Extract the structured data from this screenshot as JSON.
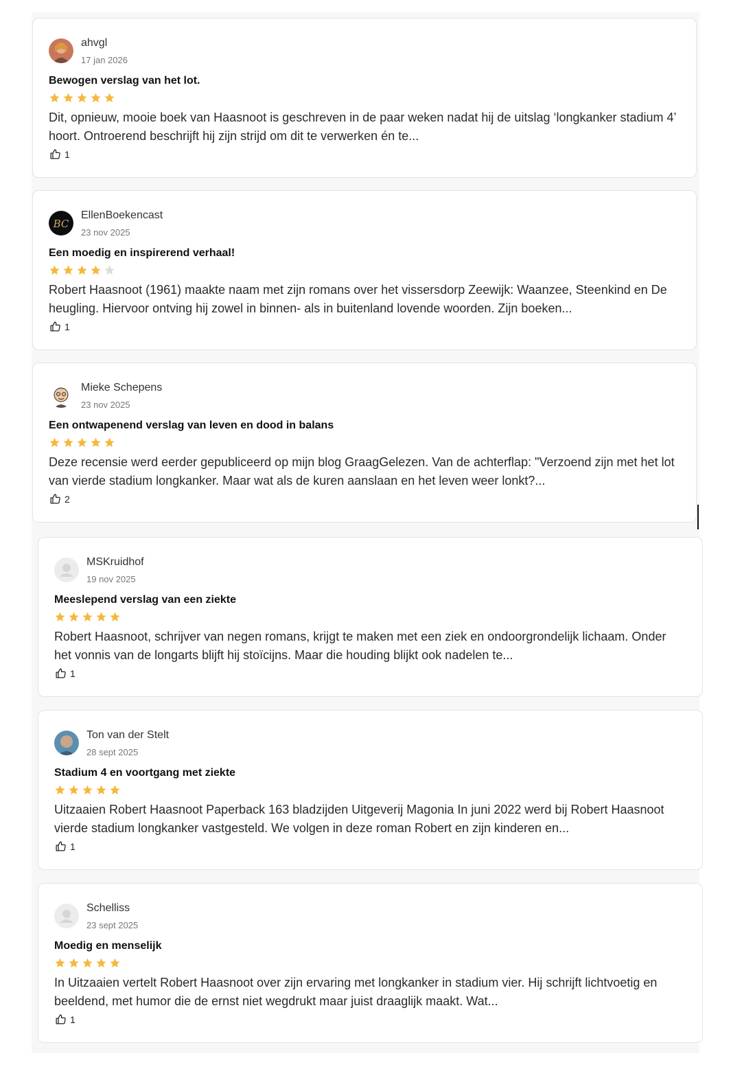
{
  "reviews": [
    {
      "author": "ahvgl",
      "date": "17 jan 2026",
      "title": "Bewogen verslag van het lot.",
      "rating": 5,
      "body": "Dit, opnieuw, mooie boek van Haasnoot is geschreven in de paar weken nadat hij de uitslag ‘longkanker stadium 4’ hoort. Ontroerend beschrijft hij zijn strijd om dit te verwerken én te...",
      "likes": "1",
      "avatar_icon": "user-photo-icon"
    },
    {
      "author": "EllenBoekencast",
      "date": "23 nov 2025",
      "title": "Een moedig en inspirerend verhaal!",
      "rating": 4,
      "body": "Robert Haasnoot (1961) maakte naam met zijn romans over het vissersdorp Zeewijk: Waanzee, Steenkind en De heugling. Hiervoor ontving hij zowel in binnen- als in buitenland lovende woorden. Zijn boeken...",
      "likes": "1",
      "avatar_icon": "bc-logo-icon"
    },
    {
      "author": "Mieke Schepens",
      "date": "23 nov 2025",
      "title": "Een ontwapenend verslag van leven en dood in balans",
      "rating": 5,
      "body": "Deze recensie werd eerder gepubliceerd op mijn blog GraagGelezen. Van de achterflap: \"Verzoend zijn met het lot van vierde stadium longkanker. Maar wat als de kuren aanslaan en het leven weer lonkt?...",
      "likes": "2",
      "avatar_icon": "cartoon-avatar-icon"
    },
    {
      "author": "MSKruidhof",
      "date": "19 nov 2025",
      "title": "Meeslepend verslag van een ziekte",
      "rating": 5,
      "body": "Robert Haasnoot, schrijver van negen romans, krijgt te maken met een ziek en ondoorgrondelijk lichaam. Onder het vonnis van de longarts blijft hij stoïcijns. Maar die houding blijkt ook nadelen te...",
      "likes": "1",
      "avatar_icon": "default-avatar-icon"
    },
    {
      "author": "Ton van der Stelt",
      "date": "28 sept 2025",
      "title": "Stadium 4 en voortgang met ziekte",
      "rating": 5,
      "body": "Uitzaaien Robert Haasnoot Paperback 163 bladzijden Uitgeverij Magonia In juni 2022 werd bij Robert Haasnoot vierde stadium longkanker vastgesteld. We volgen in deze roman Robert en zijn kinderen en...",
      "likes": "1",
      "avatar_icon": "user-photo-icon"
    },
    {
      "author": "Schelliss",
      "date": "23 sept 2025",
      "title": "Moedig en menselijk",
      "rating": 5,
      "body": "In Uitzaaien vertelt Robert Haasnoot over zijn ervaring met longkanker in stadium vier. Hij schrijft lichtvoetig en beeldend, met humor die de ernst niet wegdrukt maar juist draaglijk maakt. Wat...",
      "likes": "1",
      "avatar_icon": "default-avatar-icon"
    }
  ],
  "colors": {
    "star_filled": "#f5b83d",
    "star_empty": "#dcdcdc",
    "card_border": "#e4e4e4"
  }
}
